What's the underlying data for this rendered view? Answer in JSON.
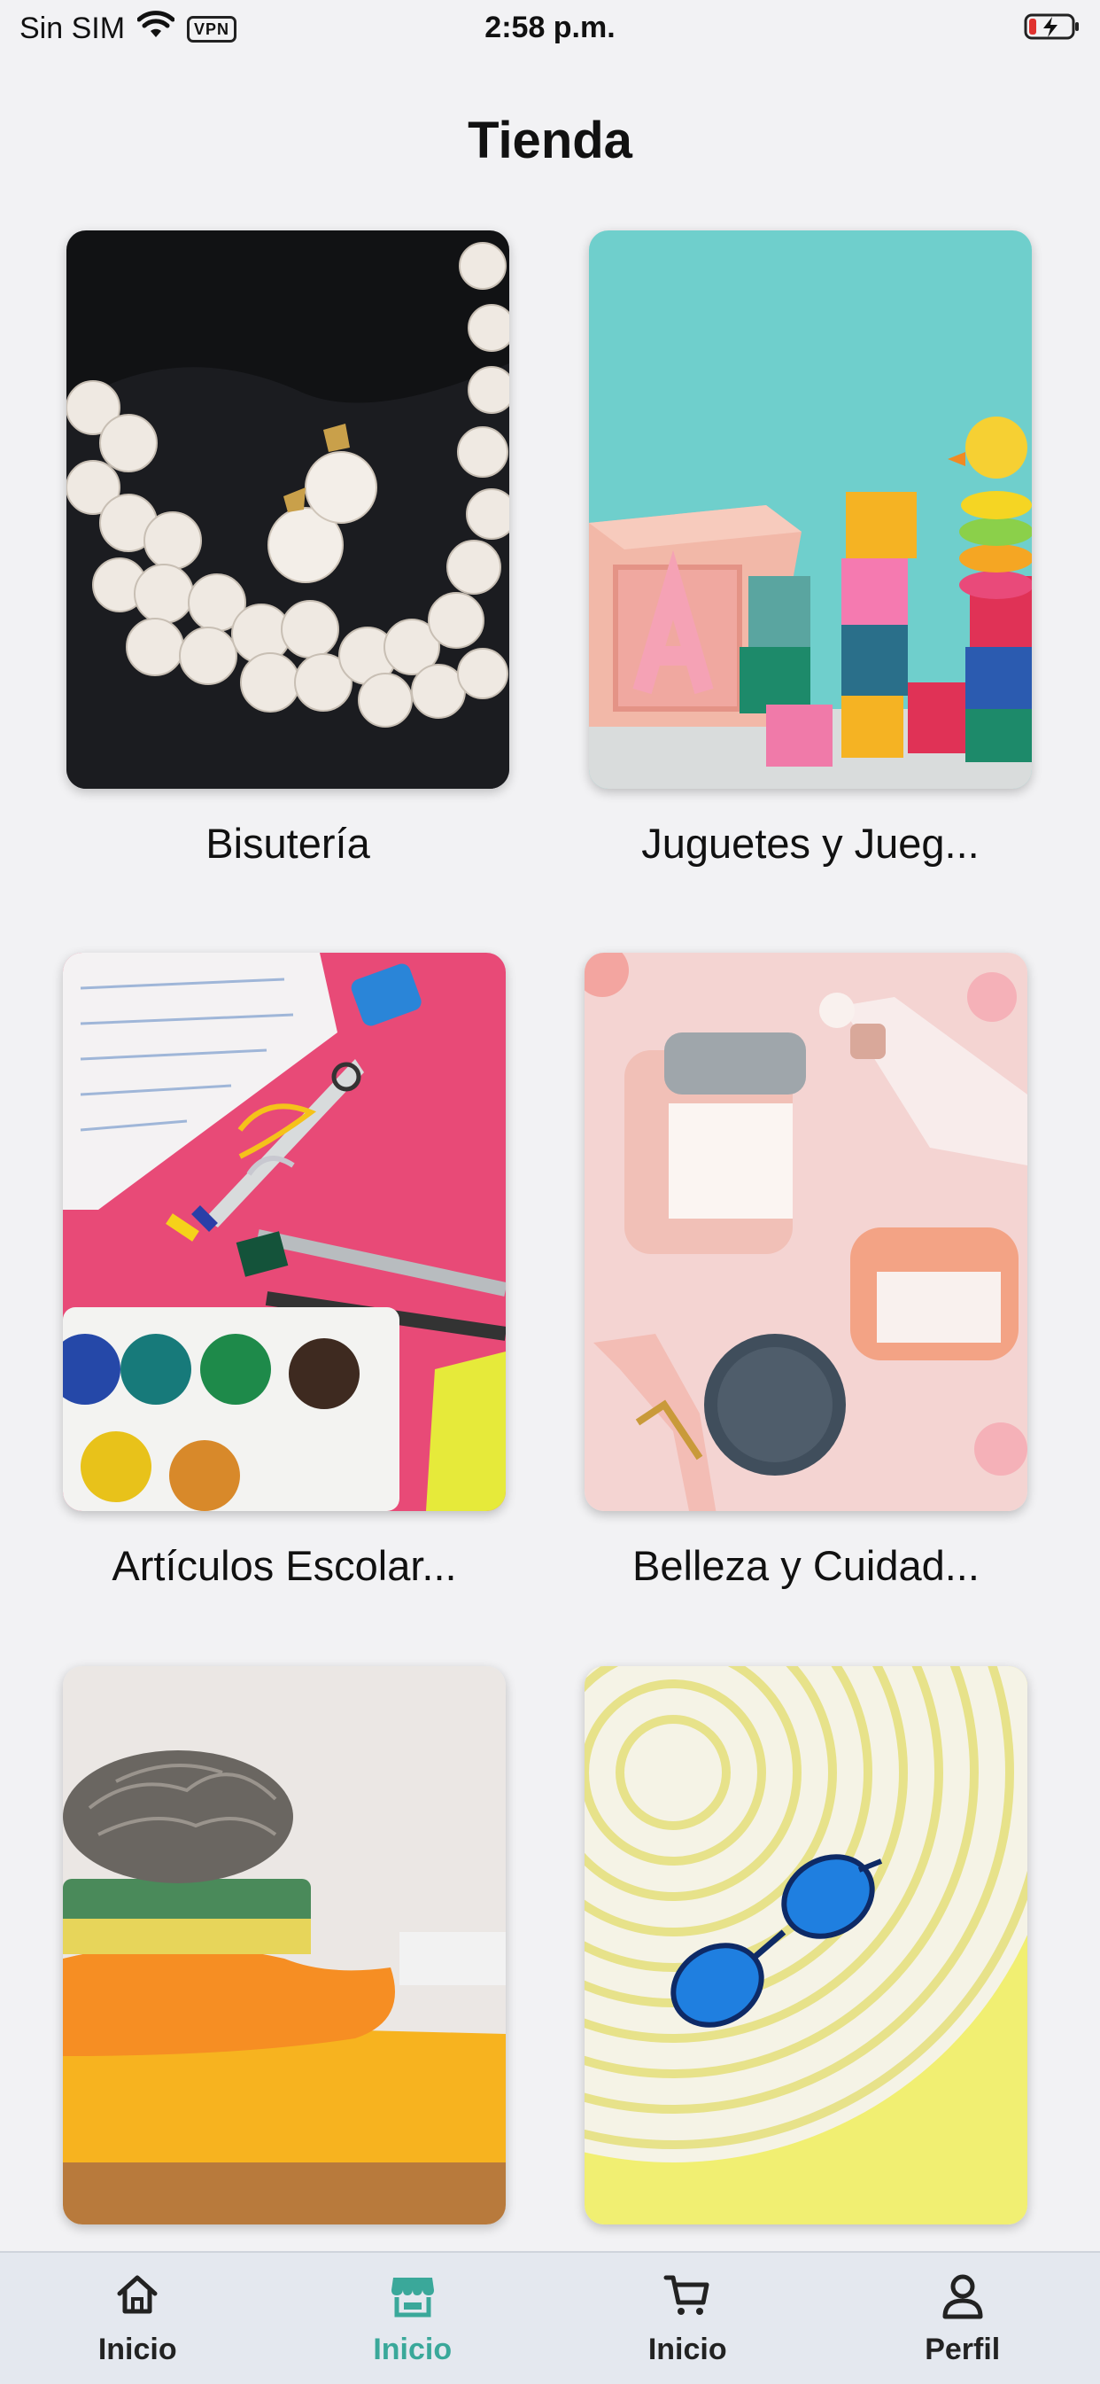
{
  "status_bar": {
    "carrier": "Sin SIM",
    "vpn": "VPN",
    "time": "2:58 p.m."
  },
  "header": {
    "title": "Tienda"
  },
  "categories": [
    {
      "label": "Bisutería",
      "image": "pearls-photo"
    },
    {
      "label": "Juguetes y Jueg...",
      "image": "toys-blocks-photo"
    },
    {
      "label": "Artículos Escolar...",
      "image": "school-supplies-photo"
    },
    {
      "label": "Belleza y Cuidad...",
      "image": "cosmetics-photo"
    },
    {
      "label": "",
      "image": "cleaning-supplies-photo"
    },
    {
      "label": "",
      "image": "beach-hat-sunglasses-photo"
    }
  ],
  "tab_bar": {
    "items": [
      {
        "label": "Inicio",
        "icon": "home-icon",
        "active": false
      },
      {
        "label": "Inicio",
        "icon": "store-icon",
        "active": true
      },
      {
        "label": "Inicio",
        "icon": "cart-icon",
        "active": false
      },
      {
        "label": "Perfil",
        "icon": "user-icon",
        "active": false
      }
    ],
    "active_color": "#3aa89a"
  }
}
